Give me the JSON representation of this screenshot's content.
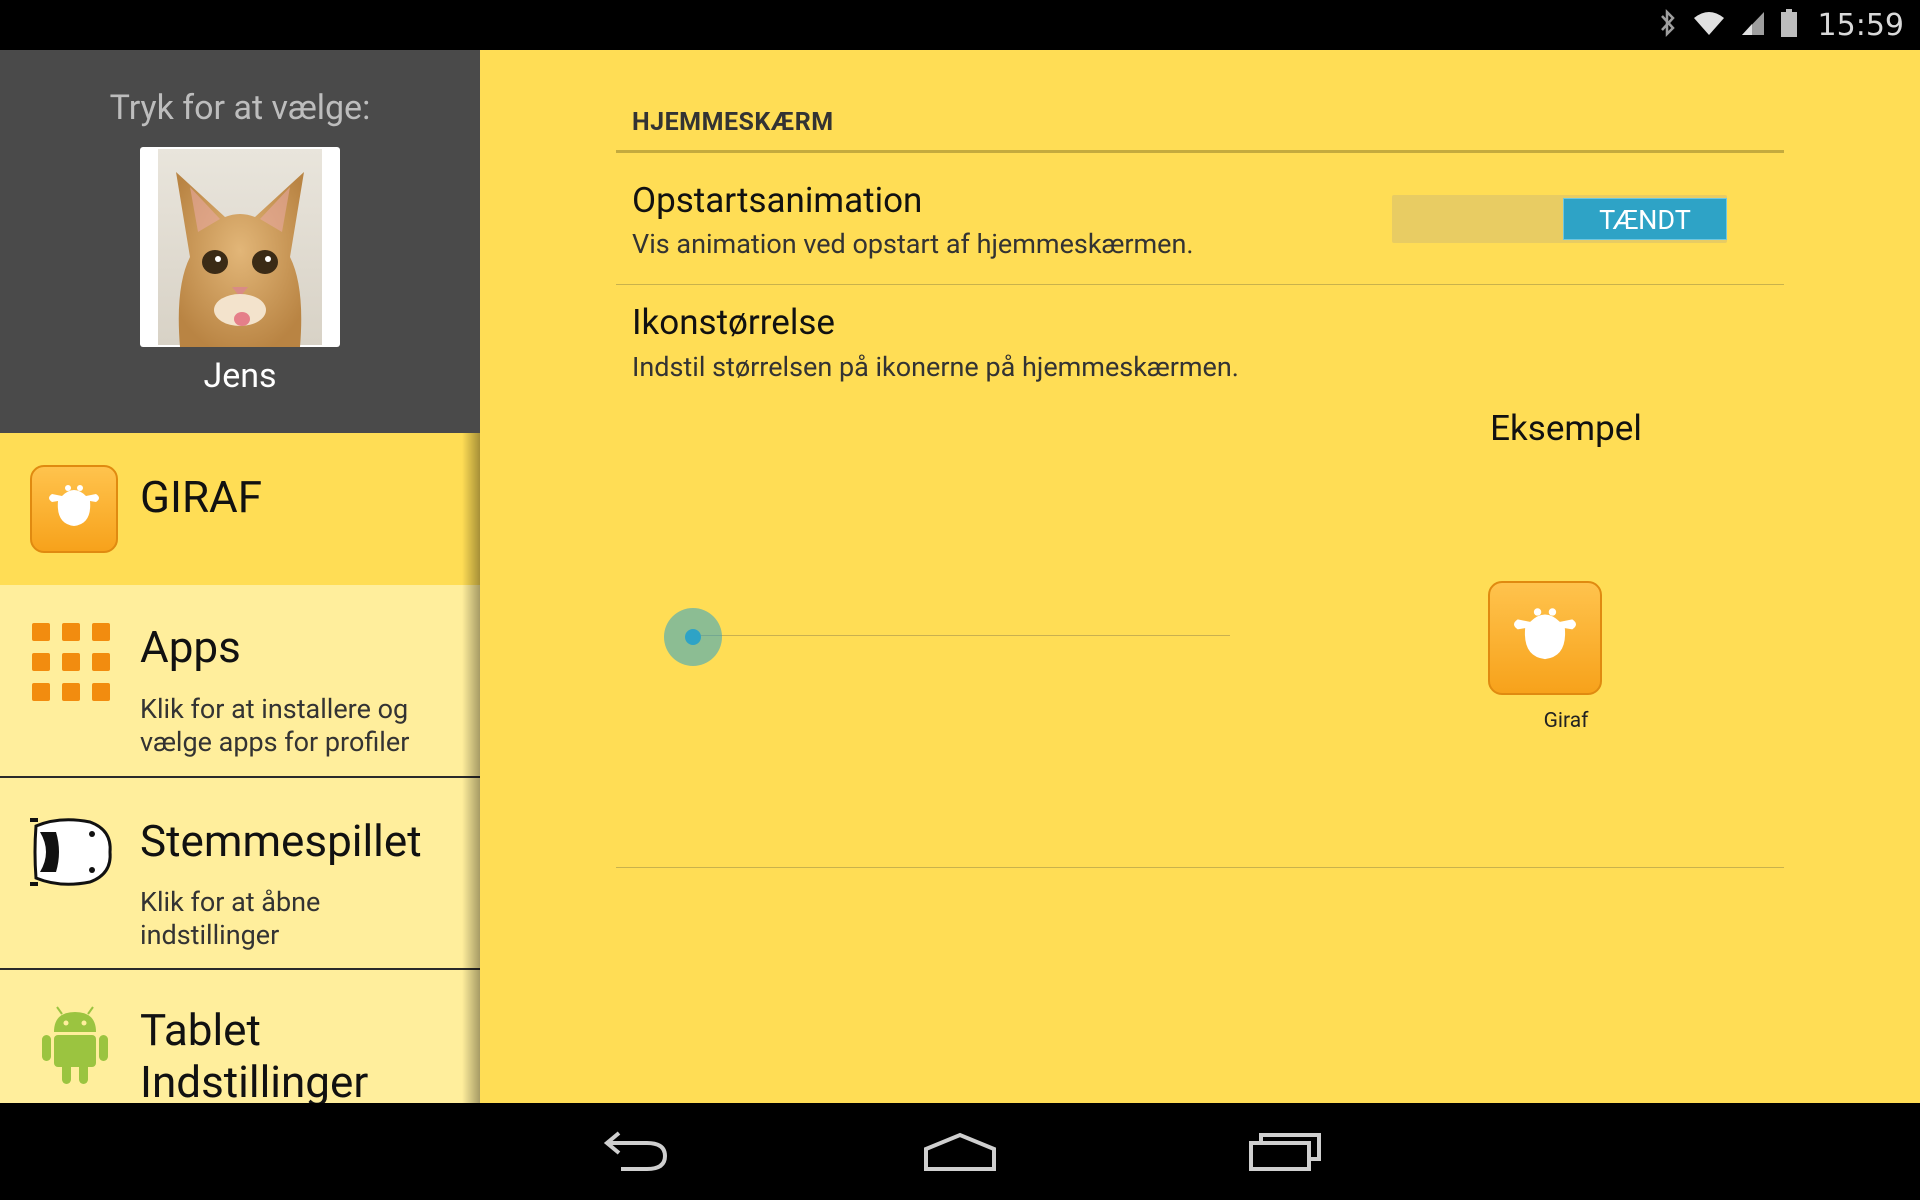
{
  "status_bar": {
    "time": "15:59",
    "icons": [
      "bluetooth-icon",
      "wifi-icon",
      "signal-icon",
      "battery-icon"
    ]
  },
  "sidebar": {
    "profile": {
      "prompt": "Tryk for at vælge:",
      "name": "Jens"
    },
    "items": [
      {
        "title": "GIRAF",
        "description": "",
        "icon": "giraf-icon",
        "active": true
      },
      {
        "title": "Apps",
        "description_line1": "Klik for at installere og",
        "description_line2": "vælge apps for profiler",
        "icon": "apps-grid-icon"
      },
      {
        "title": "Stemmespillet",
        "description_line1": "Klik for at åbne",
        "description_line2": "indstillinger",
        "icon": "car-icon"
      },
      {
        "title_line1": "Tablet",
        "title_line2": "Indstillinger",
        "icon": "android-icon"
      }
    ]
  },
  "main": {
    "section_header": "HJEMMESKÆRM",
    "startup_animation": {
      "title": "Opstartsanimation",
      "summary": "Vis animation ved opstart af hjemmeskærmen.",
      "toggle_label": "TÆNDT",
      "enabled": true
    },
    "icon_size": {
      "title": "Ikonstørrelse",
      "summary": "Indstil størrelsen på ikonerne på hjemmeskærmen.",
      "slider_value": 0
    },
    "example": {
      "label": "Eksempel",
      "caption": "Giraf"
    }
  },
  "nav_bar": {
    "buttons": [
      "back-icon",
      "home-icon",
      "recent-apps-icon"
    ]
  },
  "colors": {
    "accent_yellow": "#ffdd55",
    "sidebar_item_bg": "#ffee9c",
    "profile_bg": "#4a4a4a",
    "toggle_blue": "#2ea3c6",
    "giraf_orange": "#f7a21b"
  }
}
